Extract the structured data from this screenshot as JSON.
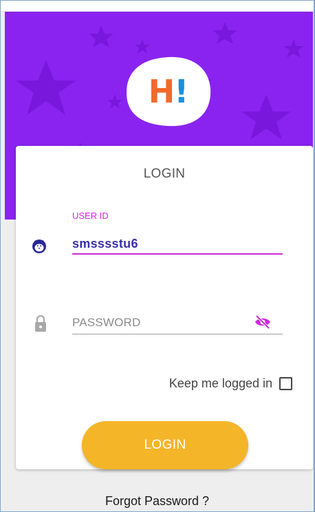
{
  "logo": {
    "letter": "H",
    "mark": "!",
    "icon": "hi-logo"
  },
  "card": {
    "title": "LOGIN"
  },
  "user_field": {
    "label": "USER ID",
    "value": "smsssstu6",
    "icon": "penguin-avatar-icon"
  },
  "password_field": {
    "placeholder": "PASSWORD",
    "icon": "lock-icon",
    "toggle_icon": "eye-off-icon"
  },
  "keep_logged_in": {
    "label": "Keep me logged in",
    "checked": false
  },
  "login_button": {
    "label": "LOGIN"
  },
  "forgot_link": {
    "label": "Forgot Password ?"
  },
  "colors": {
    "header_purple": "#8a23f0",
    "accent_magenta": "#c92bd9",
    "button_yellow": "#f4b529",
    "user_text": "#3a2fa8"
  }
}
